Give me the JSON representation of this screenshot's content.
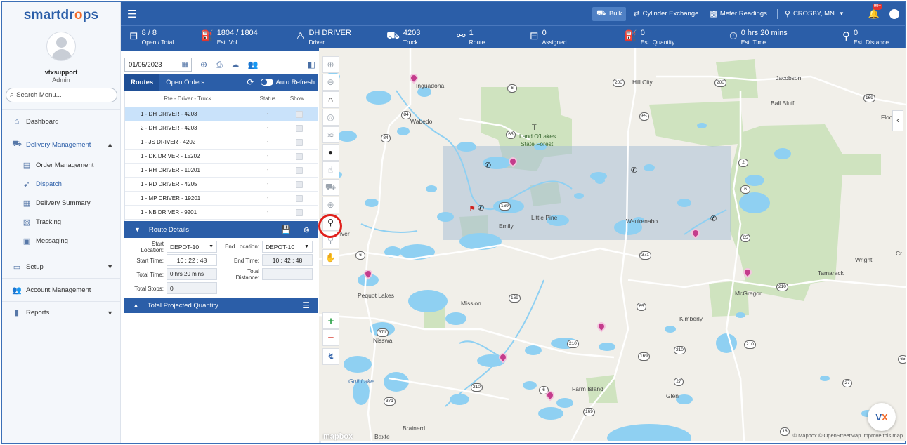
{
  "brand": {
    "name_left": "smartdr",
    "name_flame": "o",
    "name_right": "ps"
  },
  "user": {
    "name": "vtxsupport",
    "role": "Admin"
  },
  "search_menu": {
    "placeholder": "Search Menu..."
  },
  "nav": {
    "dashboard": "Dashboard",
    "delivery_management": "Delivery Management",
    "order_management": "Order Management",
    "dispatch": "Dispatch",
    "delivery_summary": "Delivery Summary",
    "tracking": "Tracking",
    "messaging": "Messaging",
    "setup": "Setup",
    "account_management": "Account Management",
    "reports": "Reports"
  },
  "topbar": {
    "bulk": "Bulk",
    "cylinder_exchange": "Cylinder Exchange",
    "meter_readings": "Meter Readings",
    "location": "CROSBY, MN",
    "notification_count": "99+"
  },
  "stats": {
    "open_total": {
      "value": "8 / 8",
      "label": "Open / Total"
    },
    "est_vol": {
      "value": "1804 / 1804",
      "label": "Est. Vol."
    },
    "driver": {
      "value": "DH DRIVER",
      "label": "Driver"
    },
    "truck": {
      "value": "4203",
      "label": "Truck"
    },
    "route": {
      "value": "1",
      "label": "Route"
    },
    "assigned": {
      "value": "0",
      "label": "Assigned"
    },
    "est_quantity": {
      "value": "0",
      "label": "Est. Quantity"
    },
    "est_time": {
      "value": "0 hrs 20 mins",
      "label": "Est. Time"
    },
    "est_distance": {
      "value": "0",
      "label": "Est. Distance"
    }
  },
  "date_filter": {
    "value": "01/05/2023"
  },
  "routes_panel": {
    "tab_routes": "Routes",
    "tab_open_orders": "Open Orders",
    "auto_refresh": "Auto Refresh",
    "col_rte": "Rte - Driver - Truck",
    "col_status": "Status",
    "col_show": "Show...",
    "rows": [
      {
        "label": "1 - DH DRIVER - 4203",
        "status": "-"
      },
      {
        "label": "2 - DH DRIVER - 4203",
        "status": "-"
      },
      {
        "label": "1 - JS DRIVER - 4202",
        "status": "-"
      },
      {
        "label": "1 - DK DRIVER - 15202",
        "status": "-"
      },
      {
        "label": "1 - RH DRIVER - 10201",
        "status": "-"
      },
      {
        "label": "1 - RD DRIVER - 4205",
        "status": "-"
      },
      {
        "label": "1 - MP DRIVER - 19201",
        "status": "-"
      },
      {
        "label": "1 - NB DRIVER - 9201",
        "status": "-"
      }
    ]
  },
  "route_details": {
    "title": "Route Details",
    "start_location_label_1": "Start",
    "start_location_label_2": "Location:",
    "start_location": "DEPOT-10",
    "end_location_label": "End Location:",
    "end_location": "DEPOT-10",
    "start_time_label": "Start Time:",
    "start_time": "10 : 22 : 48",
    "end_time_label": "End Time:",
    "end_time": "10 : 42 : 48",
    "total_time_label": "Total Time:",
    "total_time": "0 hrs 20 mins",
    "total_distance_label_1": "Total",
    "total_distance_label_2": "Distance:",
    "total_distance": "",
    "total_stops_label": "Total Stops:",
    "total_stops": "0"
  },
  "projected_quantity": {
    "title": "Total Projected Quantity"
  },
  "map": {
    "places": {
      "inguadona": "Inguadona",
      "wabedo": "Wabedo",
      "land_o_lakes": "Land O'Lakes",
      "state_forest": "State Forest",
      "hill_city": "Hill City",
      "jacobson": "Jacobson",
      "ball_bluff": "Ball Bluff",
      "floodwood": "Floodwo",
      "emily": "Emily",
      "little_pine": "Little Pine",
      "waukenabo": "Waukenabo",
      "wright": "Wright",
      "tamarack": "Tamarack",
      "mcgregor": "McGregor",
      "pequot_lakes": "Pequot Lakes",
      "mission": "Mission",
      "kimberly": "Kimberly",
      "nisswa": "Nisswa",
      "gull_lake": "Gull Lake",
      "farm_island": "Farm Island",
      "glen": "Glen",
      "brainerd": "Brainerd",
      "baxter": "Baxte",
      "river": "iver",
      "cr": "Cr"
    },
    "attribution": "© Mapbox © OpenStreetMap  Improve this map",
    "mapbox_logo": "mapbox",
    "road_labels": [
      "6",
      "84",
      "84",
      "200",
      "200",
      "169",
      "65",
      "65",
      "2",
      "6",
      "169",
      "371",
      "6",
      "169",
      "65",
      "210",
      "169",
      "65",
      "371",
      "210",
      "371",
      "210",
      "6",
      "169",
      "27",
      "27",
      "18",
      "65",
      "210",
      "210"
    ]
  }
}
